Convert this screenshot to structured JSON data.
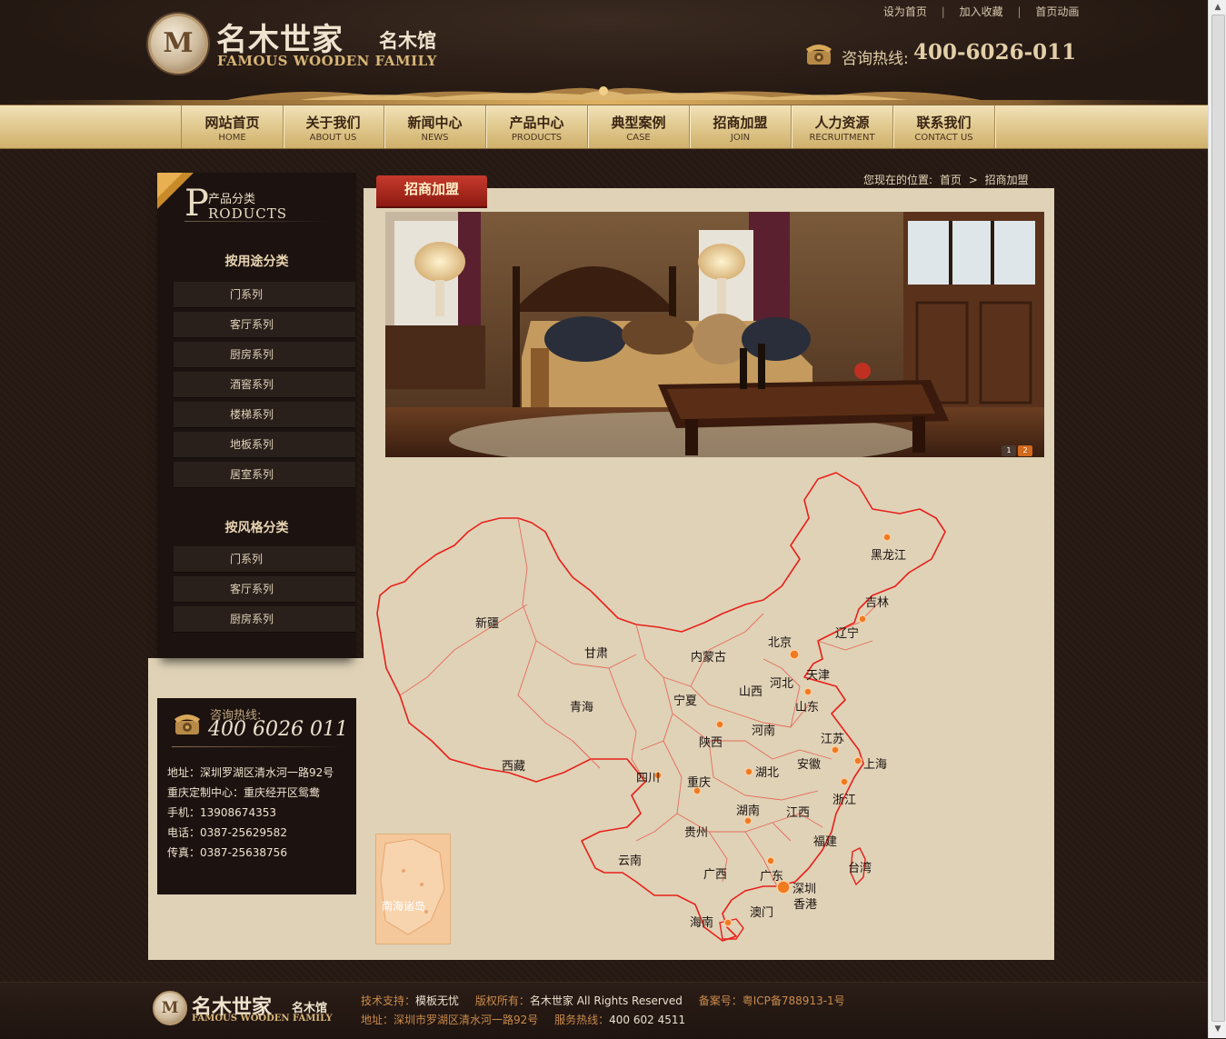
{
  "header": {
    "logo_letter": "M",
    "logo_cn": "名木世家",
    "logo_cn_sub": "名木馆",
    "logo_en": "FAMOUS WOODEN FAMILY",
    "toplinks": [
      "设为首页",
      "加入收藏",
      "首页动画"
    ],
    "toplink_separator": "|",
    "hotline_label": "咨询热线:",
    "hotline_number": "400-6026-011"
  },
  "nav": [
    {
      "cn": "网站首页",
      "en": "HOME"
    },
    {
      "cn": "关于我们",
      "en": "ABOUT US"
    },
    {
      "cn": "新闻中心",
      "en": "NEWS"
    },
    {
      "cn": "产品中心",
      "en": "PRODUCTS"
    },
    {
      "cn": "典型案例",
      "en": "CASE"
    },
    {
      "cn": "招商加盟",
      "en": "JOIN"
    },
    {
      "cn": "人力资源",
      "en": "RECRUITMENT"
    },
    {
      "cn": "联系我们",
      "en": "CONTACT US"
    }
  ],
  "sidebar": {
    "title_initial": "P",
    "title_cn": "产品分类",
    "title_en": "RODUCTS",
    "group1": {
      "heading": "按用途分类",
      "items": [
        "门系列",
        "客厅系列",
        "厨房系列",
        "酒窖系列",
        "楼梯系列",
        "地板系列",
        "居室系列"
      ]
    },
    "group2": {
      "heading": "按风格分类",
      "items": [
        "门系列",
        "客厅系列",
        "厨房系列"
      ]
    }
  },
  "contact": {
    "tel_label": "咨询热线:",
    "tel_number": "400 6026 011",
    "rows": [
      "地址：深圳罗湖区清水河一路92号",
      "重庆定制中心：重庆经开区鸳鸯",
      "手机：13908674353",
      "电话：0387-25629582",
      "传真：0387-25638756"
    ]
  },
  "main": {
    "tab_label": "招商加盟",
    "breadcrumb": [
      "您现在的位置:",
      "首页",
      ">",
      "招商加盟"
    ],
    "banner_pages": [
      "1",
      "2"
    ],
    "banner_active_page": 2
  },
  "map": {
    "provinces": [
      "新疆",
      "西藏",
      "青海",
      "甘肃",
      "内蒙古",
      "宁夏",
      "陕西",
      "四川",
      "重庆",
      "云南",
      "贵州",
      "广西",
      "湖南",
      "湖北",
      "河南",
      "山西",
      "河北",
      "北京",
      "天津",
      "山东",
      "江苏",
      "安徽",
      "上海",
      "浙江",
      "江西",
      "福建",
      "台湾",
      "广东",
      "深圳",
      "香港",
      "澳门",
      "海南",
      "辽宁",
      "吉林",
      "黑龙江"
    ],
    "inset_label": "南海诸岛",
    "colors": {
      "border": "#e8201a",
      "marker": "#f07a20",
      "inset": "#f4c89a"
    }
  },
  "footer": {
    "logo_letter": "M",
    "logo_cn": "名木世家",
    "logo_cn_sub": "名木馆",
    "logo_en": "FAMOUS WOODEN FAMILY",
    "line1": [
      {
        "k": "技术支持：",
        "v": "模板无忧"
      },
      {
        "k": "版权所有：",
        "v": "名木世家  All Rights Reserved"
      },
      {
        "k": "备案号：",
        "v": "粤ICP备788913-1号"
      }
    ],
    "line2": [
      {
        "k": "地址：",
        "v": "深圳市罗湖区清水河一路92号"
      },
      {
        "k": "服务热线：",
        "v": "400 602 4511"
      }
    ]
  }
}
